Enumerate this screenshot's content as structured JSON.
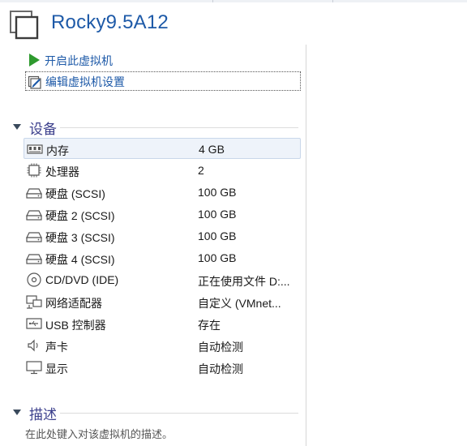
{
  "vm": {
    "title": "Rocky9.5A12"
  },
  "actions": [
    {
      "label": "开启此虚拟机",
      "icon": "play-icon"
    },
    {
      "label": "编辑虚拟机设置",
      "icon": "edit-settings-icon"
    }
  ],
  "devices_section": {
    "title": "设备"
  },
  "devices": [
    {
      "name": "内存",
      "value": "4 GB",
      "icon": "memory-icon"
    },
    {
      "name": "处理器",
      "value": "2",
      "icon": "cpu-icon"
    },
    {
      "name": "硬盘 (SCSI)",
      "value": "100 GB",
      "icon": "hard-disk-icon"
    },
    {
      "name": "硬盘 2 (SCSI)",
      "value": "100 GB",
      "icon": "hard-disk-icon"
    },
    {
      "name": "硬盘 3 (SCSI)",
      "value": "100 GB",
      "icon": "hard-disk-icon"
    },
    {
      "name": "硬盘 4 (SCSI)",
      "value": "100 GB",
      "icon": "hard-disk-icon"
    },
    {
      "name": "CD/DVD (IDE)",
      "value": "正在使用文件 D:...",
      "icon": "cd-dvd-icon"
    },
    {
      "name": "网络适配器",
      "value": "自定义 (VMnet...",
      "icon": "network-adapter-icon"
    },
    {
      "name": "USB 控制器",
      "value": "存在",
      "icon": "usb-icon"
    },
    {
      "name": "声卡",
      "value": "自动检测",
      "icon": "speaker-icon"
    },
    {
      "name": "显示",
      "value": "自动检测",
      "icon": "monitor-icon"
    }
  ],
  "description_section": {
    "title": "描述",
    "placeholder": "在此处键入对该虚拟机的描述。"
  },
  "colors": {
    "accent": "#1e5aa8",
    "section": "#3b3f8c",
    "play": "#2e9a2e"
  }
}
